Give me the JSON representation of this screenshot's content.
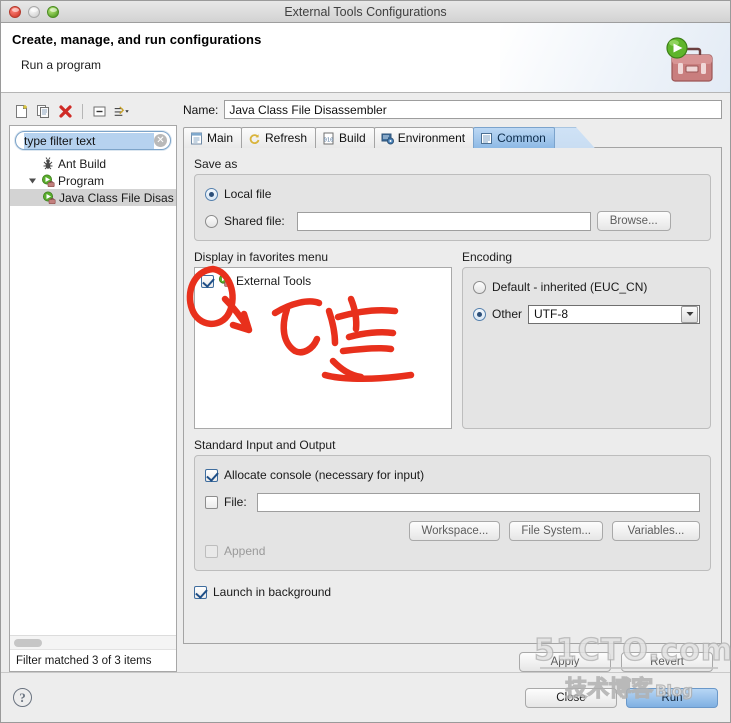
{
  "window": {
    "title": "External Tools Configurations",
    "traffic_lights": [
      "close-red",
      "minimize-gray",
      "zoom-green"
    ]
  },
  "header": {
    "title": "Create, manage, and run configurations",
    "subtitle": "Run a program",
    "icon": "toolbox-with-run-icon"
  },
  "sidebar": {
    "toolbar": [
      {
        "name": "new-configuration",
        "icon": "new-document-icon"
      },
      {
        "name": "duplicate-configuration",
        "icon": "copy-icon"
      },
      {
        "name": "delete-configuration",
        "icon": "red-x-delete-icon"
      },
      {
        "name": "collapse-all",
        "icon": "collapse-all-icon"
      },
      {
        "name": "filter-menu",
        "icon": "filter-sort-icon"
      }
    ],
    "filter": {
      "value": "type filter text",
      "placeholder": "type filter text",
      "clear_icon": "clear-circle-icon"
    },
    "tree": [
      {
        "label": "Ant Build",
        "icon": "ant-build-icon",
        "depth": 1,
        "expander": "",
        "selected": false
      },
      {
        "label": "Program",
        "icon": "program-run-icon",
        "depth": 1,
        "expander": "expanded",
        "selected": false
      },
      {
        "label": "Java Class File Disas",
        "icon": "program-run-icon",
        "depth": 2,
        "expander": "",
        "selected": true
      }
    ],
    "status": "Filter matched 3 of 3 items"
  },
  "main": {
    "name_label": "Name:",
    "name_value": "Java Class File Disassembler",
    "tabs": [
      {
        "label": "Main",
        "icon": "main-tab-icon",
        "active": false
      },
      {
        "label": "Refresh",
        "icon": "refresh-tab-icon",
        "active": false
      },
      {
        "label": "Build",
        "icon": "build-tab-icon",
        "active": false
      },
      {
        "label": "Environment",
        "icon": "environment-tab-icon",
        "active": false
      },
      {
        "label": "Common",
        "icon": "common-tab-icon",
        "active": true
      }
    ],
    "save_as": {
      "group_label": "Save as",
      "local_file": {
        "label": "Local file",
        "selected": true
      },
      "shared_file": {
        "label": "Shared file:",
        "selected": false,
        "value": ""
      },
      "browse_button": "Browse..."
    },
    "favorites": {
      "group_label": "Display in favorites menu",
      "items": [
        {
          "label": "External Tools",
          "icon": "external-tools-icon",
          "checked": true
        }
      ]
    },
    "encoding": {
      "group_label": "Encoding",
      "default": {
        "label": "Default - inherited (EUC_CN)",
        "selected": false
      },
      "other": {
        "label": "Other",
        "selected": true,
        "value": "UTF-8"
      }
    },
    "standard_io": {
      "group_label": "Standard Input and Output",
      "allocate_console": {
        "label": "Allocate console (necessary for input)",
        "checked": true
      },
      "file": {
        "label": "File:",
        "checked": false,
        "value": ""
      },
      "workspace_button": "Workspace...",
      "file_system_button": "File System...",
      "variables_button": "Variables...",
      "append": {
        "label": "Append",
        "checked": false,
        "disabled": true
      }
    },
    "launch_in_background": {
      "label": "Launch in background",
      "checked": true
    },
    "apply_button": "Apply",
    "revert_button": "Revert"
  },
  "footer": {
    "help_icon": "question-mark-help-icon",
    "close_button": "Close",
    "run_button": "Run"
  },
  "annotation": {
    "type": "handwritten-red-ink",
    "circle_with_arrow_target": "External Tools checkbox",
    "text": "勾选"
  },
  "watermark": {
    "main": "51CTO.com",
    "chinese": "技术博客",
    "blog": "Blog"
  },
  "colors": {
    "accent_blue": "#8db9e5",
    "annotation_red": "#e8301c",
    "selection_gray": "#d3d3d3",
    "panel_bg": "#ececec"
  }
}
